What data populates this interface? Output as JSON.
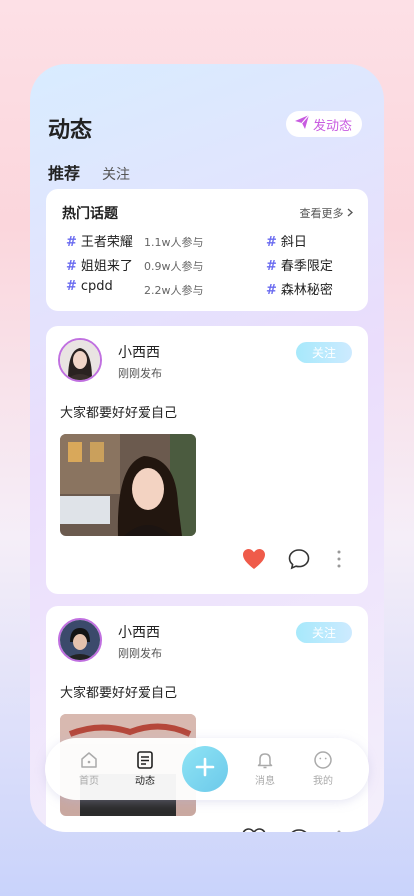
{
  "header": {
    "title": "动态",
    "post_button_label": "发动态"
  },
  "tabs": [
    "推荐",
    "关注"
  ],
  "hot_topics": {
    "title": "热门话题",
    "more_label": "查看更多",
    "items": [
      {
        "name": "王者荣耀",
        "count": "1.1w人参与"
      },
      {
        "name": "姐姐来了",
        "count": "0.9w人参与"
      },
      {
        "name": "cpdd",
        "count": "2.2w人参与"
      },
      {
        "name": "斜日",
        "count": ""
      },
      {
        "name": "春季限定",
        "count": ""
      },
      {
        "name": "森林秘密",
        "count": ""
      }
    ]
  },
  "posts": [
    {
      "username": "小西西",
      "time": "刚刚发布",
      "follow_label": "关注",
      "text": "大家都要好好爱自己"
    },
    {
      "username": "小西西",
      "time": "刚刚发布",
      "follow_label": "关注",
      "text": "大家都要好好爱自己"
    }
  ],
  "bottom_nav": [
    {
      "label": "首页",
      "icon": "home-icon"
    },
    {
      "label": "动态",
      "icon": "feed-icon"
    },
    {
      "label": "",
      "icon": "plus-icon"
    },
    {
      "label": "消息",
      "icon": "bell-icon"
    },
    {
      "label": "我的",
      "icon": "smile-icon"
    }
  ],
  "colors": {
    "accent": "#c85be0",
    "hash": "#6b6cf0",
    "heart": "#ef5b4a",
    "fab": "#7fd6ee"
  }
}
